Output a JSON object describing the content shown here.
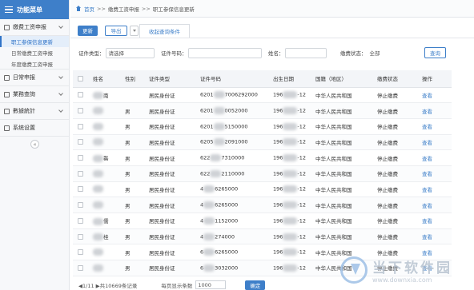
{
  "sidebar": {
    "header": "功能菜单",
    "groups": [
      {
        "label": "缴费工资申报",
        "subs": [
          {
            "label": "职工参保信息更新",
            "active": true
          },
          {
            "label": "日常缴费工资申报",
            "active": false
          },
          {
            "label": "年度缴费工资申报",
            "active": false
          }
        ]
      },
      {
        "label": "日常申报"
      },
      {
        "label": "業務查詢"
      },
      {
        "label": "數據統計"
      },
      {
        "label": "系统设置"
      }
    ],
    "collapse_glyph": "«"
  },
  "breadcrumb": {
    "home": "首页",
    "sep": ">>",
    "level2": "缴费工资申报",
    "level3": "职工参保信息更新"
  },
  "toolbar": {
    "update_label": "更新",
    "export_label": "导出",
    "tab_label": "收起查询条件"
  },
  "filter": {
    "cert_type_label": "证件类型：",
    "cert_type_value": "请选择",
    "cert_no_label": "证件号码：",
    "name_label": "姓名：",
    "status_label": "缴费状态：",
    "status_value": "全部",
    "query_label": "查询"
  },
  "table": {
    "headers": [
      "姓名",
      "性别",
      "证件类型",
      "证件号码",
      "出生日期",
      "国籍（地区）",
      "缴费状态",
      "操作"
    ],
    "rows": [
      {
        "name_tail": "南",
        "gender": "",
        "cert_type": "居民身份证",
        "id_head": "6201",
        "id_tail": "7006292000",
        "birth_head": "196",
        "birth_tail": "-12",
        "nation": "中华人民共和国",
        "status": "停止缴费",
        "action": "查看"
      },
      {
        "name_tail": "",
        "gender": "男",
        "cert_type": "居民身份证",
        "id_head": "6201",
        "id_tail": "0052000",
        "birth_head": "196",
        "birth_tail": "-12",
        "nation": "中华人民共和国",
        "status": "停止缴费",
        "action": "查看"
      },
      {
        "name_tail": "",
        "gender": "男",
        "cert_type": "居民身份证",
        "id_head": "6201",
        "id_tail": "5150000",
        "birth_head": "196",
        "birth_tail": "-12",
        "nation": "中华人民共和国",
        "status": "停止缴费",
        "action": "查看"
      },
      {
        "name_tail": "",
        "gender": "男",
        "cert_type": "居民身份证",
        "id_head": "6205",
        "id_tail": "2091000",
        "birth_head": "196",
        "birth_tail": "-12",
        "nation": "中华人民共和国",
        "status": "停止缴费",
        "action": "查看"
      },
      {
        "name_tail": "磊",
        "gender": "男",
        "cert_type": "居民身份证",
        "id_head": "622",
        "id_tail": "7310000",
        "birth_head": "196",
        "birth_tail": "-12",
        "nation": "中华人民共和国",
        "status": "停止缴费",
        "action": "查看"
      },
      {
        "name_tail": "",
        "gender": "男",
        "cert_type": "居民身份证",
        "id_head": "622",
        "id_tail": "2110000",
        "birth_head": "196",
        "birth_tail": "-12",
        "nation": "中华人民共和国",
        "status": "停止缴费",
        "action": "查看"
      },
      {
        "name_tail": "",
        "gender": "男",
        "cert_type": "居民身份证",
        "id_head": "4",
        "id_tail": "6265000",
        "birth_head": "196",
        "birth_tail": "-12",
        "nation": "中华人民共和国",
        "status": "停止缴费",
        "action": "查看"
      },
      {
        "name_tail": "",
        "gender": "男",
        "cert_type": "居民身份证",
        "id_head": "4",
        "id_tail": "6265000",
        "birth_head": "196",
        "birth_tail": "-12",
        "nation": "中华人民共和国",
        "status": "停止缴费",
        "action": "查看"
      },
      {
        "name_tail": "儒",
        "gender": "男",
        "cert_type": "居民身份证",
        "id_head": "4",
        "id_tail": "1152000",
        "birth_head": "196",
        "birth_tail": "-12",
        "nation": "中华人民共和国",
        "status": "停止缴费",
        "action": "查看"
      },
      {
        "name_tail": "桂",
        "gender": "男",
        "cert_type": "居民身份证",
        "id_head": "4",
        "id_tail": "274000",
        "birth_head": "196",
        "birth_tail": "-12",
        "nation": "中华人民共和国",
        "status": "停止缴费",
        "action": "查看"
      },
      {
        "name_tail": "",
        "gender": "男",
        "cert_type": "居民身份证",
        "id_head": "6",
        "id_tail": "6265000",
        "birth_head": "196",
        "birth_tail": "-12",
        "nation": "中华人民共和国",
        "status": "停止缴费",
        "action": "查看"
      },
      {
        "name_tail": "",
        "gender": "男",
        "cert_type": "居民身份证",
        "id_head": "6",
        "id_tail": "3032000",
        "birth_head": "196",
        "birth_tail": "-12",
        "nation": "中华人民共和国",
        "status": "停止缴费",
        "action": "查看"
      }
    ]
  },
  "pager": {
    "summary": "◀1/11 ▶共10669条记录",
    "page_size_label": "每页显示条数",
    "page_size_value": "1000",
    "go_label": "确定"
  },
  "watermark": {
    "cn": "当下软件园",
    "url": "www.downxia.com"
  },
  "colors": {
    "accent": "#3e7fc9",
    "sidebar_bg": "#f7f8fa",
    "header_bg": "#f3f5f8"
  }
}
